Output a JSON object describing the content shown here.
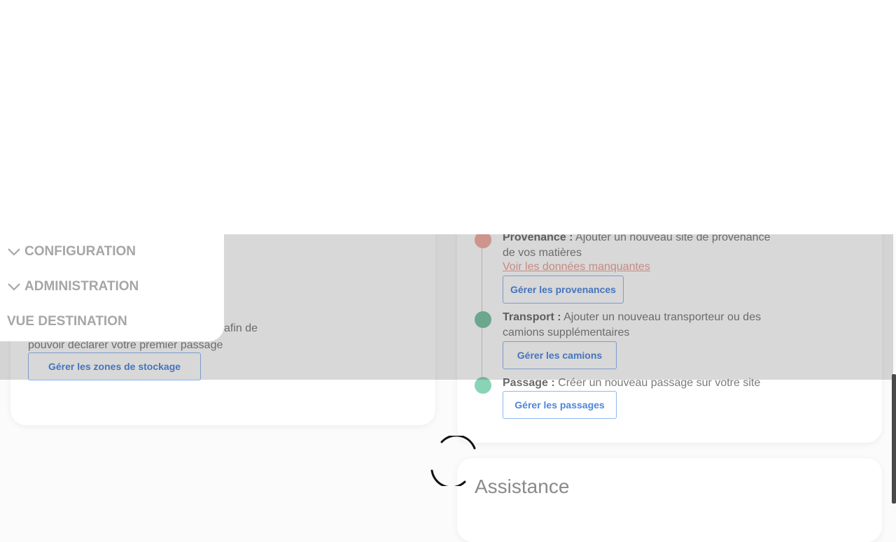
{
  "menu": {
    "items": [
      {
        "label": "CONFIGURATION",
        "icon": "chevron-down-icon"
      },
      {
        "label": "ADMINISTRATION",
        "icon": "chevron-down-icon"
      },
      {
        "label": "VUE DESTINATION"
      }
    ]
  },
  "storage": {
    "description_partial": "afin de pouvoir déclarer votre premier passage",
    "button": "Gérer les zones de stockage"
  },
  "steps": {
    "provenance": {
      "title": "Provenance :",
      "text": "Ajouter un nouveau site de provenance de vos matières",
      "link": "Voir les données manquantes",
      "button": "Gérer les provenances",
      "color": "#f2aea3"
    },
    "transport": {
      "title": "Transport :",
      "text": "Ajouter un nouveau transporteur ou des camions supplémentaires",
      "button": "Gérer les camions",
      "color": "#7bc4a4"
    },
    "passage": {
      "title": "Passage :",
      "text": "Créer un nouveau passage sur votre site",
      "button": "Gérer les passages",
      "color": "#89d4b6"
    }
  },
  "assistance": {
    "title": "Assistance"
  },
  "colors": {
    "accent": "#4d86de",
    "overlay": "rgba(40,40,40,0.18)"
  }
}
